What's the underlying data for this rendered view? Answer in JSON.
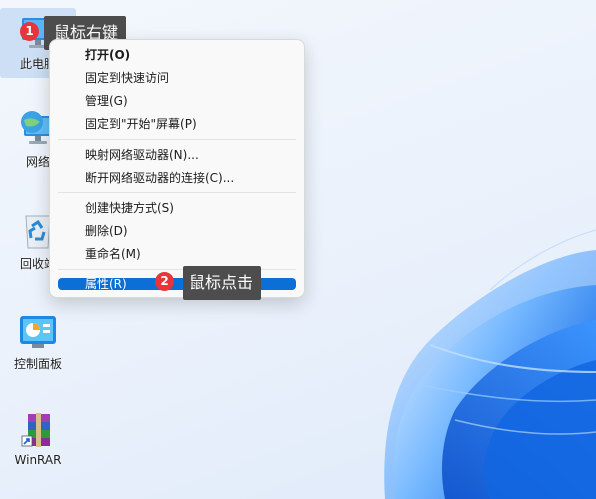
{
  "desktop_icons": [
    {
      "label": "此电脑",
      "icon": "monitor-icon"
    },
    {
      "label": "网络",
      "icon": "network-globe-icon"
    },
    {
      "label": "回收站",
      "icon": "recycle-bin-icon"
    },
    {
      "label": "控制面板",
      "icon": "control-panel-icon"
    },
    {
      "label": "WinRAR",
      "icon": "winrar-books-icon"
    }
  ],
  "context_menu": {
    "items": [
      {
        "label": "打开(O)",
        "bold": true
      },
      {
        "label": "固定到快速访问"
      },
      {
        "label": "管理(G)"
      },
      {
        "label": "固定到\"开始\"屏幕(P)"
      },
      {
        "label": "映射网络驱动器(N)..."
      },
      {
        "label": "断开网络驱动器的连接(C)..."
      },
      {
        "label": "创建快捷方式(S)"
      },
      {
        "label": "删除(D)"
      },
      {
        "label": "重命名(M)"
      },
      {
        "label": "属性(R)",
        "highlighted": true
      }
    ]
  },
  "annotations": [
    {
      "number": "1",
      "text": "鼠标右键"
    },
    {
      "number": "2",
      "text": "鼠标点击"
    }
  ],
  "colors": {
    "accent": "#0b6fd6",
    "badge": "#e8343a",
    "callout_bg": "#4d4d4d",
    "wallpaper_blue": "#1a7cf0"
  }
}
